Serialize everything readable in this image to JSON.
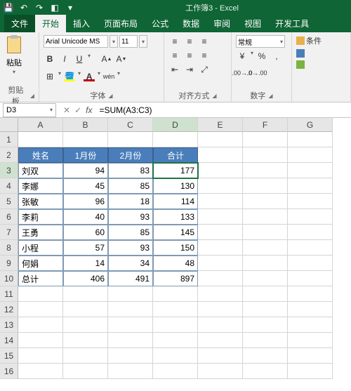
{
  "app": {
    "title": "工作簿3 - Excel"
  },
  "tabs": {
    "file": "文件",
    "home": "开始",
    "insert": "插入",
    "pagelayout": "页面布局",
    "formulas": "公式",
    "data": "数据",
    "review": "审阅",
    "view": "视图",
    "developer": "开发工具"
  },
  "ribbon": {
    "clipboard": {
      "label": "剪贴板",
      "paste": "粘贴"
    },
    "font": {
      "label": "字体",
      "name": "Arial Unicode MS",
      "size": "11"
    },
    "alignment": {
      "label": "对齐方式"
    },
    "number": {
      "label": "数字",
      "format": "常规"
    },
    "styles": {
      "cond": "条件"
    }
  },
  "namebox": "D3",
  "formula": "=SUM(A3:C3)",
  "columns": [
    "A",
    "B",
    "C",
    "D",
    "E",
    "F",
    "G"
  ],
  "rows": [
    "1",
    "2",
    "3",
    "4",
    "5",
    "6",
    "7",
    "8",
    "9",
    "10",
    "11",
    "12",
    "13",
    "14",
    "15",
    "16"
  ],
  "table": {
    "headers": [
      "姓名",
      "1月份",
      "2月份",
      "合计"
    ],
    "data": [
      [
        "刘双",
        "94",
        "83",
        "177"
      ],
      [
        "李娜",
        "45",
        "85",
        "130"
      ],
      [
        "张敏",
        "96",
        "18",
        "114"
      ],
      [
        "李莉",
        "40",
        "93",
        "133"
      ],
      [
        "王勇",
        "60",
        "85",
        "145"
      ],
      [
        "小程",
        "57",
        "93",
        "150"
      ],
      [
        "何娟",
        "14",
        "34",
        "48"
      ],
      [
        "总计",
        "406",
        "491",
        "897"
      ]
    ]
  },
  "active_cell": {
    "row": 3,
    "col": "D"
  },
  "chart_data": {
    "type": "table",
    "categories": [
      "刘双",
      "李娜",
      "张敏",
      "李莉",
      "王勇",
      "小程",
      "何娟",
      "总计"
    ],
    "series": [
      {
        "name": "1月份",
        "values": [
          94,
          45,
          96,
          40,
          60,
          57,
          14,
          406
        ]
      },
      {
        "name": "2月份",
        "values": [
          83,
          85,
          18,
          93,
          85,
          93,
          34,
          491
        ]
      },
      {
        "name": "合计",
        "values": [
          177,
          130,
          114,
          133,
          145,
          150,
          48,
          897
        ]
      }
    ]
  }
}
